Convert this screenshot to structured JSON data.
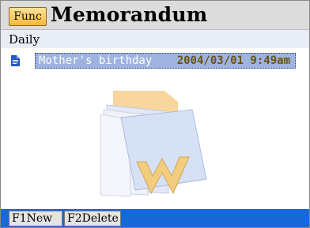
{
  "header": {
    "func_label": "Func",
    "title": "Memorandum"
  },
  "category": {
    "label": "Daily"
  },
  "memos": [
    {
      "name": "Mother's birthday",
      "datetime": "2004/03/01 9:49am",
      "icon": "document-icon"
    }
  ],
  "watermark": {
    "icon": "folder-logo-icon"
  },
  "softkeys": {
    "key1_label": "F1New",
    "key2_label": "F2Delete"
  },
  "colors": {
    "bottom_bar": "#1768d8",
    "selection": "#9fb3e0",
    "func_button": "#f6b83b"
  }
}
